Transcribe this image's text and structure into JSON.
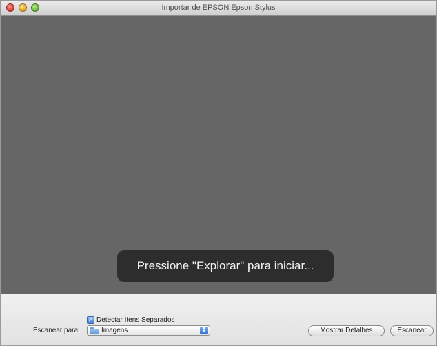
{
  "window": {
    "title": "Importar de EPSON Epson Stylus"
  },
  "preview": {
    "hint": "Pressione \"Explorar\" para iniciar..."
  },
  "options": {
    "detect_separate_items_label": "Detectar Itens Separados",
    "detect_separate_items_checked": true,
    "scan_to_label": "Escanear para:",
    "scan_to_value": "Imagens"
  },
  "buttons": {
    "show_details": "Mostrar Detalhes",
    "scan": "Escanear"
  },
  "icons": {
    "close": "close-traffic-light-icon",
    "minimize": "minimize-traffic-light-icon",
    "zoom": "zoom-traffic-light-icon",
    "folder": "folder-icon",
    "select_arrows": "popup-arrows-icon",
    "checkbox_check": "checkmark-icon"
  }
}
